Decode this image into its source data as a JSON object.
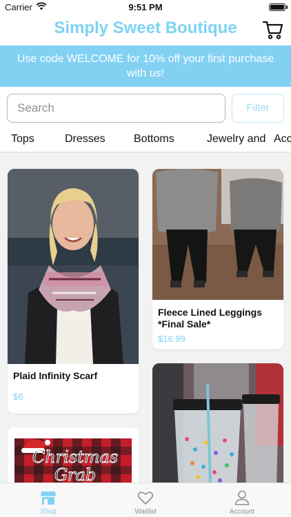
{
  "status_bar": {
    "carrier": "Carrier",
    "time": "9:51 PM"
  },
  "header": {
    "title": "Simply Sweet Boutique",
    "cart_icon": "cart-icon"
  },
  "promo": {
    "text": "Use code WELCOME for 10% off your first purchase with us!"
  },
  "search": {
    "placeholder": "Search",
    "value": "",
    "filter_label": "Filter"
  },
  "category_tabs": [
    "Tops",
    "Dresses",
    "Bottoms",
    "Jewelry and",
    "Acc"
  ],
  "products": [
    {
      "name": "Plaid Infinity Scarf",
      "price": "$6"
    },
    {
      "name": "Fleece Lined Leggings *Final Sale*",
      "price": "$16.99"
    },
    {
      "name": "",
      "price": "",
      "image_text": "Christmas Grab"
    },
    {
      "name": "",
      "price": ""
    }
  ],
  "tab_bar": [
    {
      "label": "Shop",
      "icon": "shop-icon",
      "active": true
    },
    {
      "label": "Waitlist",
      "icon": "heart-icon",
      "active": false
    },
    {
      "label": "Account",
      "icon": "account-icon",
      "active": false
    }
  ],
  "colors": {
    "accent": "#82d1f3",
    "title": "#7dd3f2",
    "grid_bg": "#f2f2f2"
  }
}
